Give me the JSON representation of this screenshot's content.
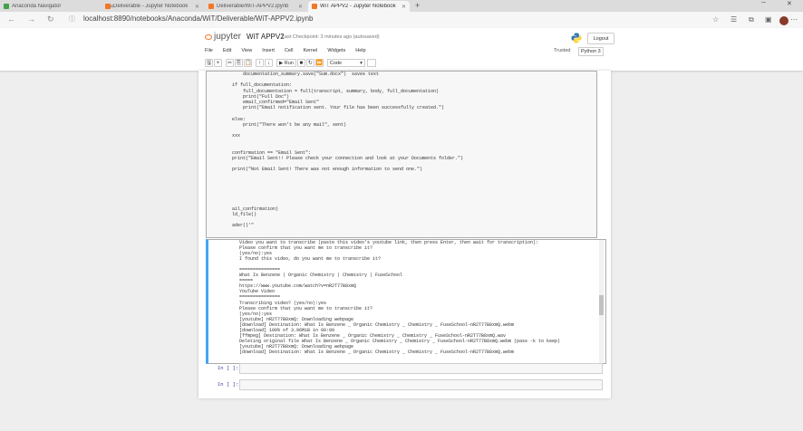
{
  "tabs": [
    {
      "title": "Anaconda Navigator",
      "active": false,
      "favicon_color": "#43a047"
    },
    {
      "title": "Deliverable - Jupyter Notebook",
      "active": false,
      "favicon_color": "#f37726"
    },
    {
      "title": "Deliverable/WiT-APPV2.ipynb",
      "active": false,
      "favicon_color": "#f37726"
    },
    {
      "title": "WiT APPV2 - Jupyter Notebook",
      "active": true,
      "favicon_color": "#f37726"
    }
  ],
  "address": {
    "url": "localhost:8890/notebooks/Anaconda/WiT/Deliverable/WiT-APPV2.ipynb"
  },
  "header": {
    "logo_text": "jupyter",
    "notebook_name": "WiT APPV2",
    "checkpoint": "Last Checkpoint: 3 minutes ago  (autosaved)",
    "logout": "Logout",
    "trusted": "Trusted",
    "kernel": "Python 3"
  },
  "menu": [
    "File",
    "Edit",
    "View",
    "Insert",
    "Cell",
    "Kernel",
    "Widgets",
    "Help"
  ],
  "toolbar": {
    "run_label": "Run",
    "cell_type": "Code"
  },
  "code_lines": [
    "    documentation_summary.save(\"Sum.docx\")  saves text",
    "",
    "if full_documentation:",
    "    full_documentation = full(transcript, summary, body, full_documentation)",
    "    print(\"Full Doc\")",
    "    email_confirmed=\"Email Sent\"",
    "    print(\"Email notification sent. Your file has been successfully created.\")",
    "",
    "else:",
    "    print(\"There won't be any mail\", sent)",
    "",
    "xxx",
    "",
    "",
    "confirmation == \"Email Sent\":",
    "print(\"Email Sent!! Please check your connection and look at your Documents folder.\")",
    "",
    "print(\"Not Email Sent! There was not enough information to send one.\")",
    "",
    "",
    "",
    "",
    "",
    "",
    "ail_confirmation)",
    "ld_file()",
    "",
    "ader()'\""
  ],
  "output_lines": [
    "Video you want to transcribe (paste this video's youtube link, then press Enter, then wait for transcription):",
    "Please confirm that you want me to transcribe it?",
    "(yes/no):yes",
    "I found this video, do you want me to transcribe it?",
    "",
    "===============",
    "What Is Benzene | Organic Chemistry | Chemistry | FuseSchool",
    "=====",
    "https://www.youtube.com/watch?v=nR2T77B8xmQ",
    "YouTube Video",
    "===============",
    "Transcribing video? (yes/no):yes",
    "Please confirm that you want me to transcribe it?",
    "(yes/no):yes",
    "[youtube] nR2T77B8xmQ: Downloading webpage",
    "[download] Destination: What Is Benzene _ Organic Chemistry _ Chemistry _ FuseSchool-nR2T77B8xmQ.webm",
    "[download] 100% of 3.96MiB in 00:00",
    "[ffmpeg] Destination: What Is Benzene _ Organic Chemistry _ Chemistry _ FuseSchool-nR2T77B8xmQ.wav",
    "Deleting original file What Is Benzene _ Organic Chemistry _ Chemistry _ FuseSchool-nR2T77B8xmQ.webm (pass -k to keep)",
    "[youtube] nR2T77B8xmQ: Downloading webpage",
    "[download] Destination: What Is Benzene _ Organic Chemistry _ Chemistry _ FuseSchool-nR2T77B8xmQ.webm"
  ],
  "empty_cells": [
    {
      "prompt": "In  [ ]:"
    },
    {
      "prompt": "In  [ ]:"
    }
  ]
}
